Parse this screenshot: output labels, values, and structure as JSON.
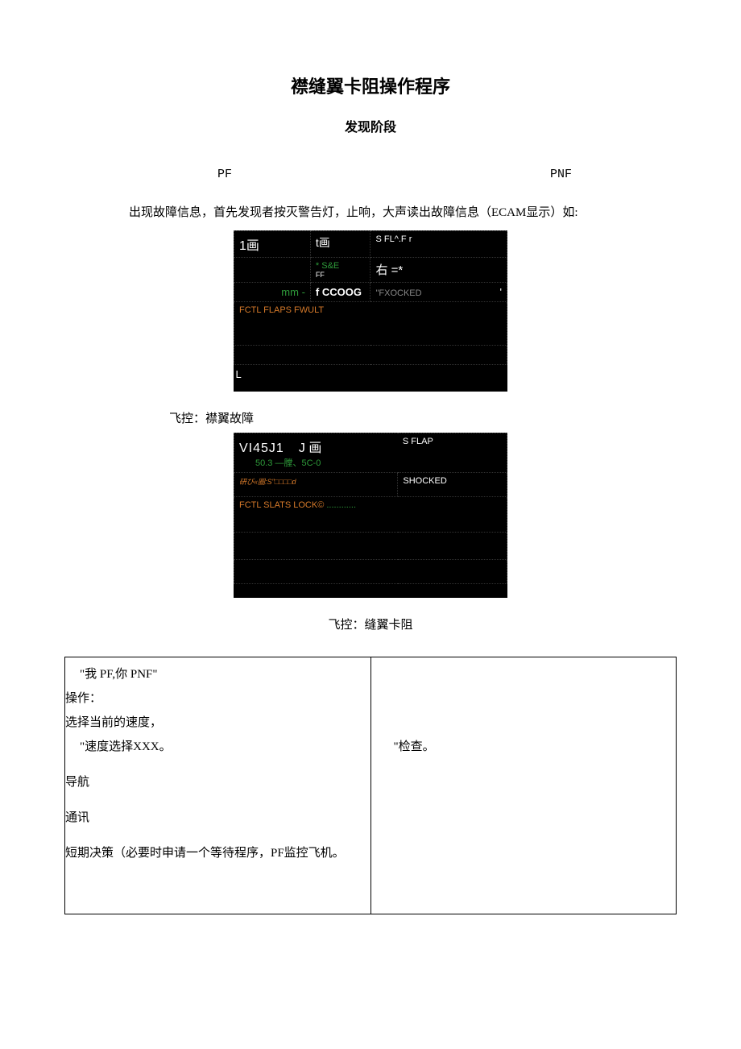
{
  "title": "襟缝翼卡阻操作程序",
  "subtitle": "发现阶段",
  "roles": {
    "pf": "PF",
    "pnf": "PNF"
  },
  "intro": "出现故障信息，首先发现者按灭警告灯，止响，大声读出故障信息（ECAM显示）如:",
  "ecam1": {
    "r1c1": "1画",
    "r1c2": "t画",
    "r1c3": "S FL^.F r",
    "r2a": "* S&E",
    "r2b": "右 =*",
    "r2c": "FF",
    "r3a": "mm -",
    "r3b": "f CCOOG",
    "r3c": "\"FXOCKED",
    "r3d": "'",
    "r4": "FCTL FLAPS FWULT",
    "rL": "L"
  },
  "caption1": "飞控：襟翼故障",
  "ecam2": {
    "r1a": "VI45J1",
    "r1b": "J 画",
    "r1c": "S FLAP",
    "r2": "50.3 —膛、5C-0",
    "r3a": "研び«圈:S\"□□□□d",
    "r3b": "SHOCKED",
    "r4": "FCTL SLATS LOCK©"
  },
  "caption2": "飞控：缝翼卡阻",
  "table": {
    "left": {
      "line1": "\"我 PF,你 PNF\"",
      "line2": "操作：",
      "line3": "选择当前的速度，",
      "line4": "\"速度选择XXX。",
      "line5": "导航",
      "line6": "通讯",
      "line7": "短期决策（必要时申请一个等待程序，PF监控飞机。"
    },
    "right": {
      "line1": "\"检查。"
    }
  }
}
